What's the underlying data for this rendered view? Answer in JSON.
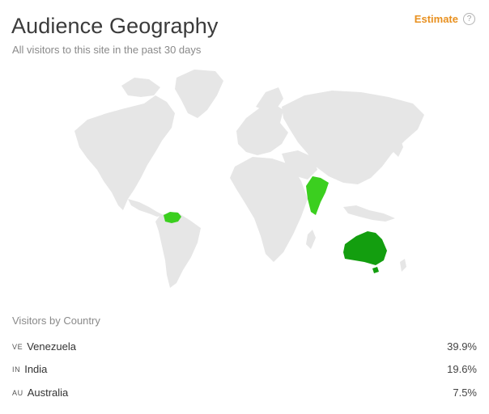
{
  "header": {
    "title": "Audience Geography",
    "subtitle": "All visitors to this site in the past 30 days",
    "estimate_label": "Estimate",
    "help_glyph": "?"
  },
  "map": {
    "base_color": "#e6e6e6",
    "highlight_colors": {
      "VE": "#3bcf1f",
      "IN": "#3bcf1f",
      "AU": "#139e0f"
    }
  },
  "visitors_by_country": {
    "title": "Visitors by Country",
    "rows": [
      {
        "code": "VE",
        "country": "Venezuela",
        "value": "39.9%"
      },
      {
        "code": "IN",
        "country": "India",
        "value": "19.6%"
      },
      {
        "code": "AU",
        "country": "Australia",
        "value": "7.5%"
      }
    ]
  }
}
